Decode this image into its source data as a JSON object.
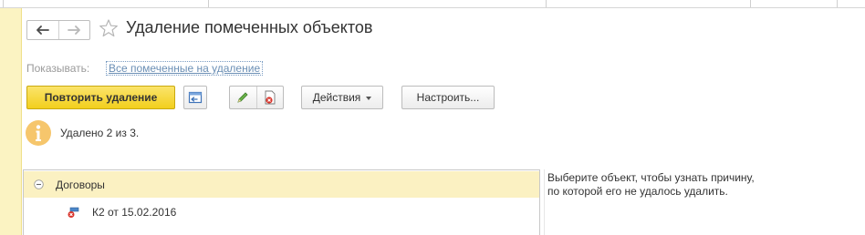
{
  "window": {
    "title": "Удаление помеченных объектов",
    "back_icon": "arrow-left-icon",
    "forward_icon": "arrow-right-icon",
    "favorite_icon": "star-icon"
  },
  "filter": {
    "label": "Показывать:",
    "value": "Все помеченные на удаление"
  },
  "toolbar": {
    "repeat_label": "Повторить удаление",
    "actions_label": "Действия",
    "settings_label": "Настроить..."
  },
  "info": {
    "message": "Удалено 2 из 3."
  },
  "tree": {
    "group_label": "Договоры",
    "items": [
      {
        "label": "К2 от 15.02.2016"
      }
    ]
  },
  "hint": {
    "line1": "Выберите объект, чтобы узнать причину,",
    "line2": "по которой его не удалось удалить."
  },
  "colors": {
    "accent_yellow": "#f2cf1d",
    "row_highlight": "#fbf1c2",
    "link": "#6b8fb5"
  }
}
